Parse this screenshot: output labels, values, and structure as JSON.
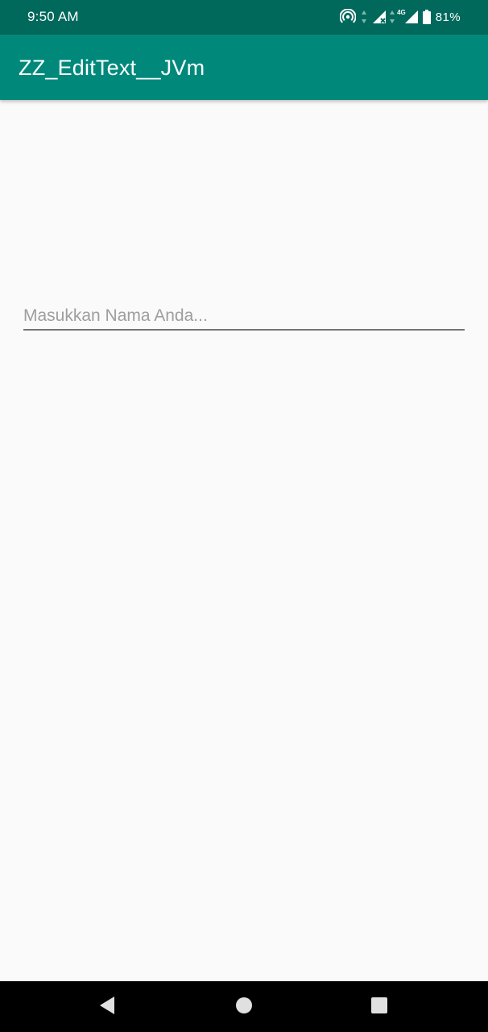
{
  "status_bar": {
    "time": "9:50 AM",
    "network_type": "4G",
    "battery_percent": "81%",
    "icons": [
      "hotspot-icon",
      "data-arrows-icon",
      "signal-no-service-icon",
      "data-arrows-icon",
      "signal-icon",
      "battery-icon"
    ]
  },
  "app_bar": {
    "title": "ZZ_EditText__JVm",
    "color": "#00897b"
  },
  "form": {
    "name_input": {
      "value": "",
      "placeholder": "Masukkan Nama Anda..."
    }
  },
  "nav_bar": {
    "icons": [
      "back-icon",
      "home-icon",
      "recents-icon"
    ]
  },
  "colors": {
    "status_bar": "#00695c",
    "primary": "#00897b",
    "background": "#fafafa",
    "nav_bar": "#000000"
  }
}
